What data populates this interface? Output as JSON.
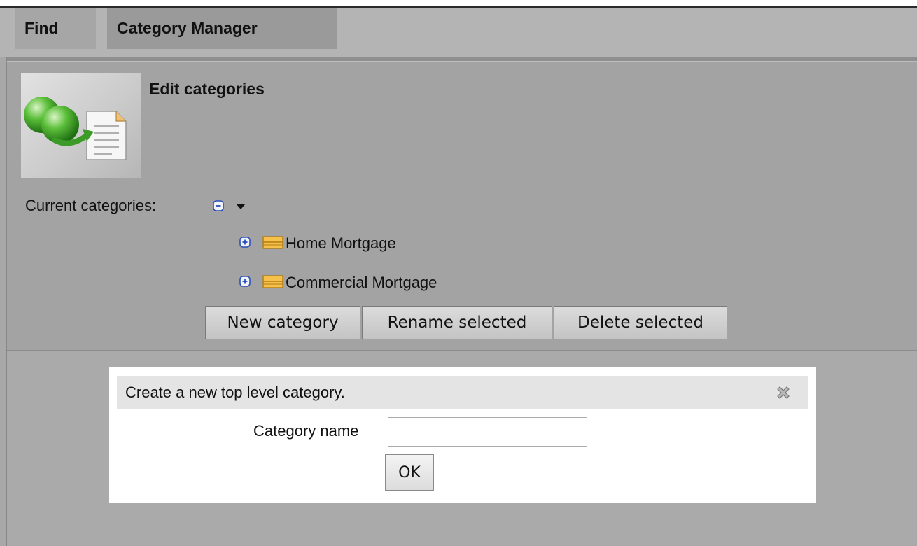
{
  "tabs": [
    {
      "label": "Find"
    },
    {
      "label": "Category Manager"
    }
  ],
  "header": {
    "title": "Edit categories",
    "icon": "category-manager-icon"
  },
  "tree": {
    "label": "Current categories:",
    "items": [
      {
        "label": "Home Mortgage"
      },
      {
        "label": "Commercial Mortgage"
      }
    ]
  },
  "actions": {
    "new_label": "New category",
    "rename_label": "Rename selected",
    "delete_label": "Delete selected"
  },
  "dialog": {
    "title": "Create a new top level category.",
    "field_label": "Category name",
    "field_value": "",
    "ok_label": "OK"
  },
  "colors": {
    "background": "#aaaaaa",
    "tree_icon_blue": "#2a4fb8",
    "folder_orange": "#e0a020"
  }
}
